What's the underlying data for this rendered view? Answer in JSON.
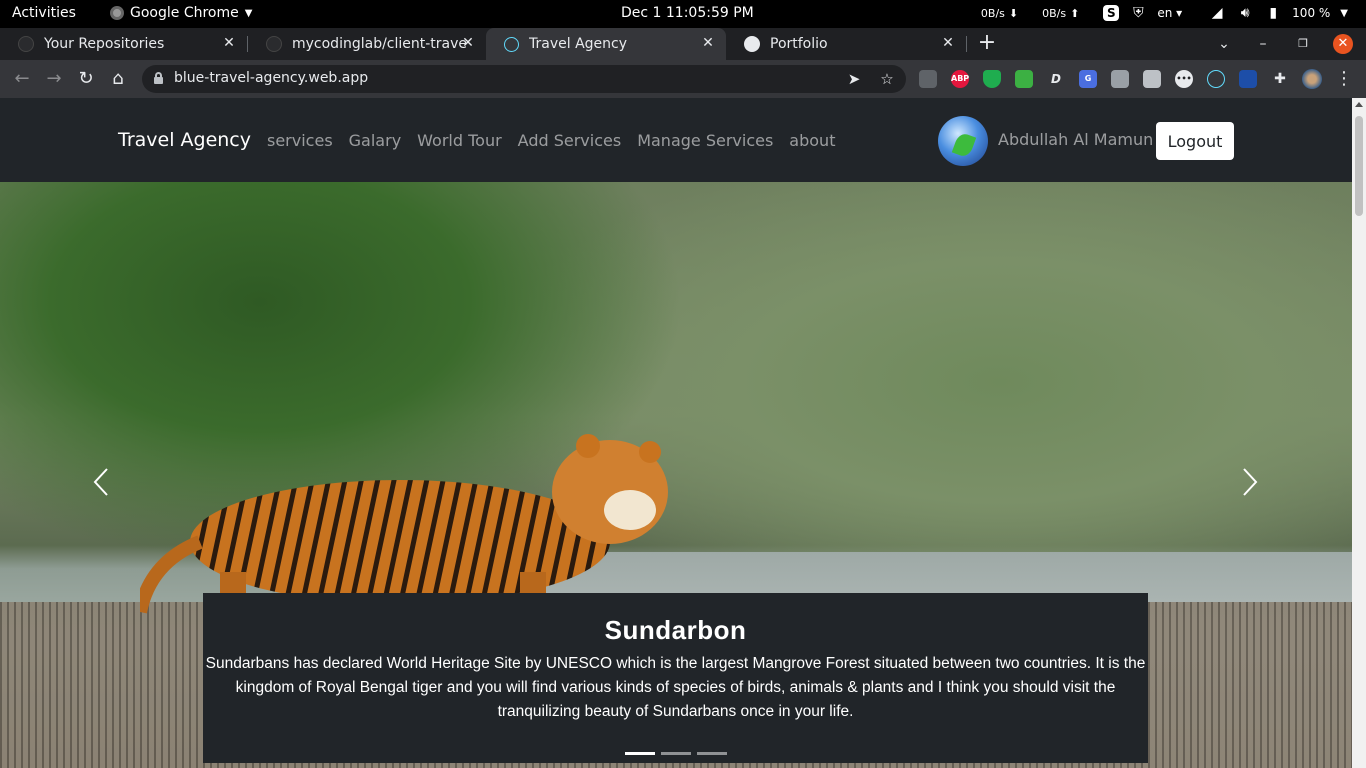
{
  "system_bar": {
    "activities": "Activities",
    "app_name": "Google Chrome",
    "datetime": "Dec 1  11:05:59 PM",
    "net_down": "0B/s",
    "net_up": "0B/s",
    "language": "en",
    "battery": "100 %"
  },
  "tabs": [
    {
      "title": "Your Repositories",
      "icon": "github-icon"
    },
    {
      "title": "mycodinglab/client-travel",
      "icon": "github-icon"
    },
    {
      "title": "Travel Agency",
      "icon": "react-icon",
      "active": true
    },
    {
      "title": "Portfolio",
      "icon": "globe-icon"
    }
  ],
  "omnibox": {
    "url": "blue-travel-agency.web.app"
  },
  "extensions": [
    "mail-icon",
    "adblock-icon",
    "shield-icon",
    "download-icon",
    "dictionary-icon",
    "translate-icon",
    "screenshot-icon",
    "note-icon",
    "dots-icon",
    "react-devtools-icon",
    "vpn-icon",
    "puzzle-icon",
    "profile-icon"
  ],
  "navbar": {
    "brand": "Travel Agency",
    "links": [
      "services",
      "Galary",
      "World Tour",
      "Add Services",
      "Manage Services",
      "about"
    ],
    "username": "Abdullah Al Mamun",
    "logout": "Logout"
  },
  "carousel": {
    "slide_title": "Sundarbon",
    "slide_text": "Sundarbans has declared World Heritage Site by UNESCO which is the largest Mangrove Forest situated between two countries. It is the kingdom of Royal Bengal tiger and you will find various kinds of species of birds, animals & plants and I think you should visit the tranquilizing beauty of Sundarbans once in your life.",
    "indicator_count": 3,
    "active_index": 0
  },
  "colors": {
    "navbar_bg": "#212529",
    "chrome_tabstrip": "#1f2023",
    "chrome_toolbar": "#35363a"
  }
}
